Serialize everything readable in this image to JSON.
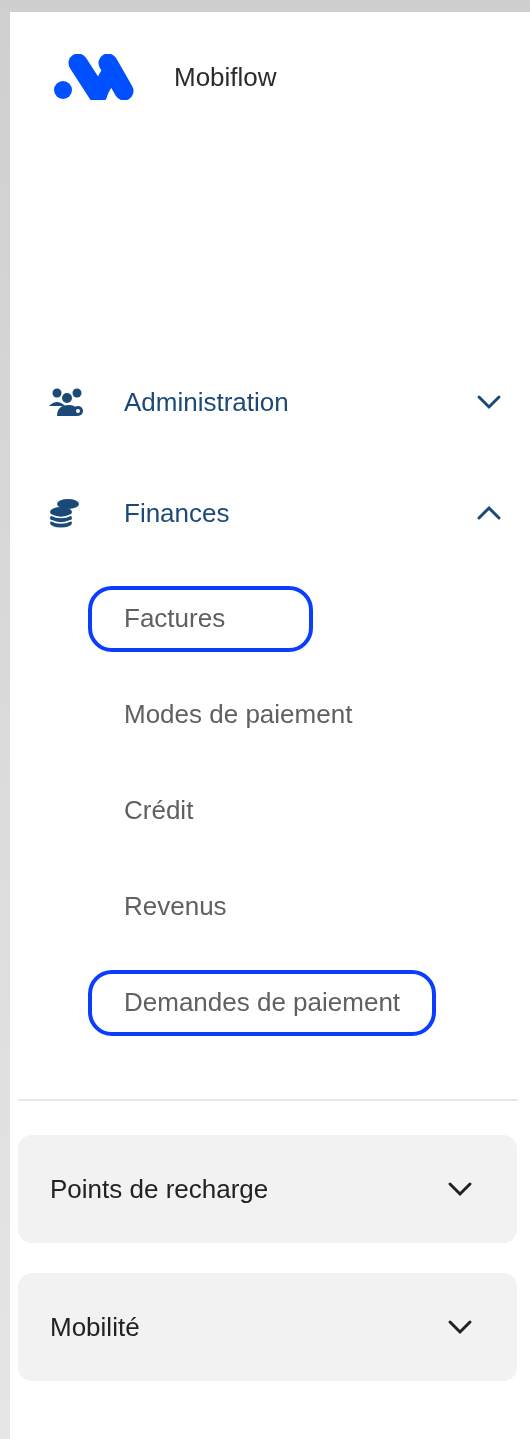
{
  "brand": {
    "name": "Mobiflow"
  },
  "nav": [
    {
      "label": "Administration",
      "expanded": false
    },
    {
      "label": "Finances",
      "expanded": true,
      "children": [
        {
          "label": "Factures",
          "highlighted": true
        },
        {
          "label": "Modes de paiement",
          "highlighted": false
        },
        {
          "label": "Crédit",
          "highlighted": false
        },
        {
          "label": "Revenus",
          "highlighted": false
        },
        {
          "label": "Demandes de paiement",
          "highlighted": true
        }
      ]
    }
  ],
  "sections": [
    {
      "label": "Points de recharge",
      "expanded": false
    },
    {
      "label": "Mobilité",
      "expanded": false
    }
  ]
}
